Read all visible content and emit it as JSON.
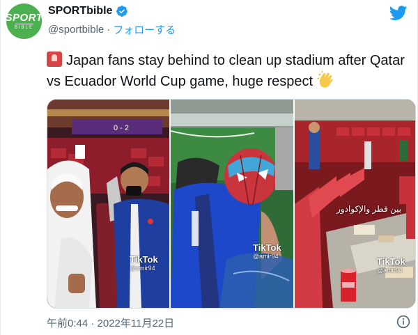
{
  "account": {
    "display_name": "SPORTbible",
    "handle": "@sportbible",
    "separator": "·",
    "follow_label": "フォローする",
    "avatar_text_top": "SPORT",
    "avatar_text_bottom": "BIBLE"
  },
  "tweet": {
    "text": "Japan fans stay behind to clean up stadium after Qatar vs Ecuador World Cup game, huge respect",
    "timestamp": "午前0:44 · 2022年11月22日"
  },
  "media": {
    "watermarks": [
      {
        "brand": "TikTok",
        "user": "@amir94"
      },
      {
        "brand": "TikTok",
        "user": "@amir94"
      },
      {
        "brand": "TikTok",
        "user": "@amir94"
      }
    ],
    "scoreboard": "0 - 2",
    "arabic_caption": "بين قطر والإكوادور"
  },
  "icons": [
    "verified-badge-icon",
    "twitter-bird-icon",
    "siren-emoji-icon",
    "clapping-hands-emoji-icon",
    "info-icon"
  ],
  "colors": {
    "accent": "#1d9bf0",
    "avatar_bg": "#4caf50",
    "text": "#0f1419",
    "muted": "#536471"
  }
}
